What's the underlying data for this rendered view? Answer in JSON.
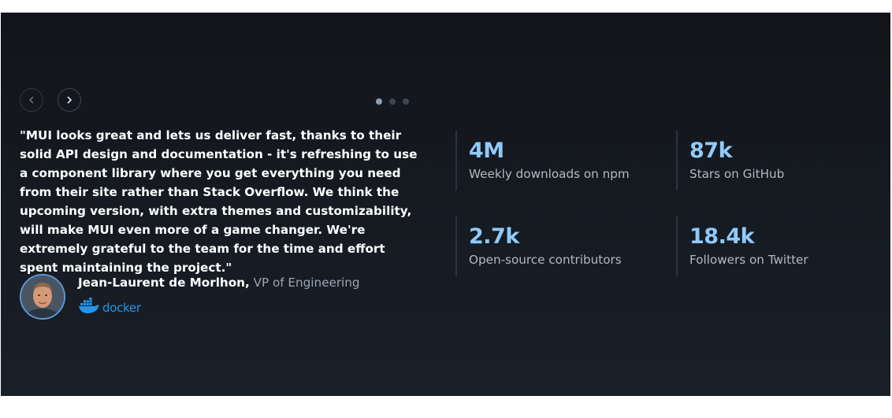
{
  "carousel": {
    "prev_icon": "chevron-left-icon",
    "next_icon": "chevron-right-icon",
    "slide_count": 3,
    "active_slide": 1
  },
  "testimonial": {
    "quote": "\"MUI looks great and lets us deliver fast, thanks to their solid API design and documentation - it's refreshing to use a component library where you get everything you need from their site rather than Stack Overflow. We think the upcoming version, with extra themes and customizability, will make MUI even more of a game changer. We're extremely grateful to the team for the time and effort spent maintaining the project.\"",
    "author_name": "Jean-Laurent de Morlhon,",
    "author_role": "VP of Engineering",
    "company": "docker",
    "company_logo_icon": "docker-whale-icon"
  },
  "stats": [
    {
      "value": "4M",
      "label": "Weekly downloads on npm"
    },
    {
      "value": "87k",
      "label": "Stars on GitHub"
    },
    {
      "value": "2.7k",
      "label": "Open-source contributors"
    },
    {
      "value": "18.4k",
      "label": "Followers on Twitter"
    }
  ],
  "colors": {
    "background": "#14181f",
    "stat_value": "#90caf9",
    "docker_blue": "#2496ed",
    "avatar_border": "#5a9ad6"
  }
}
